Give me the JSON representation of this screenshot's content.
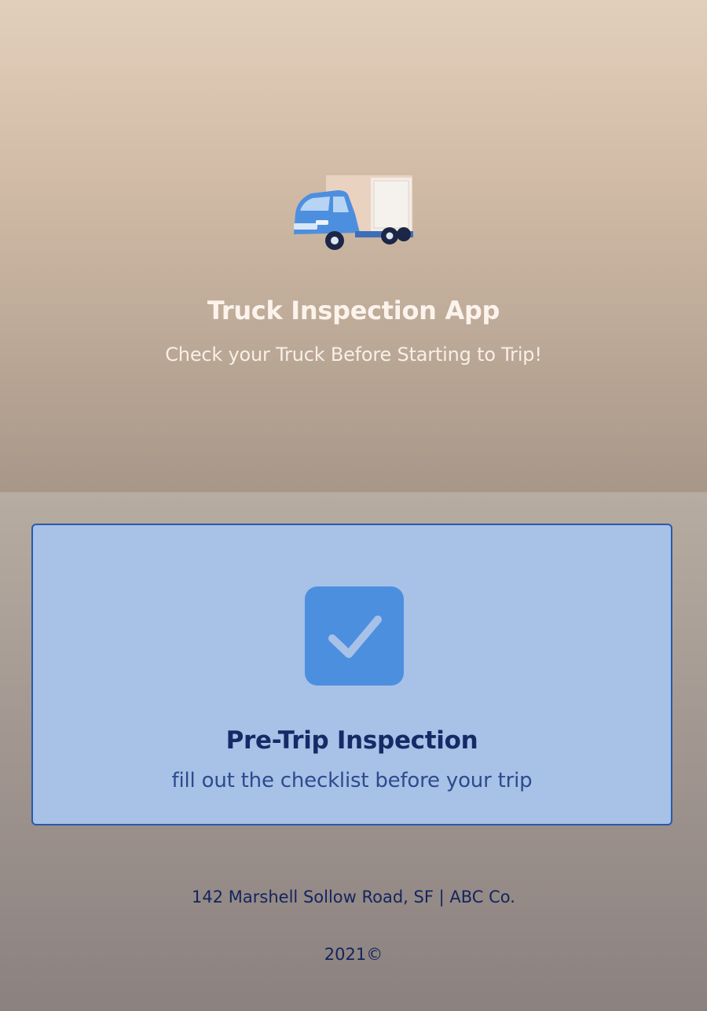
{
  "header": {
    "illustration_icon": "delivery-truck-icon",
    "title": "Truck Inspection App",
    "subtitle": "Check your Truck Before Starting to Trip!"
  },
  "inspection_card": {
    "icon": "checkmark-icon",
    "title": "Pre-Trip Inspection",
    "subtitle": "fill out the checklist before your trip"
  },
  "footer": {
    "address": "142 Marshell Sollow Road, SF | ABC Co.",
    "copyright": "2021©"
  },
  "colors": {
    "card_background": "#a7c1e7",
    "card_border": "#2a5aa7",
    "check_tile": "#4d8fdf",
    "title_text": "#142b67",
    "subtitle_text": "#2d4b8c"
  }
}
